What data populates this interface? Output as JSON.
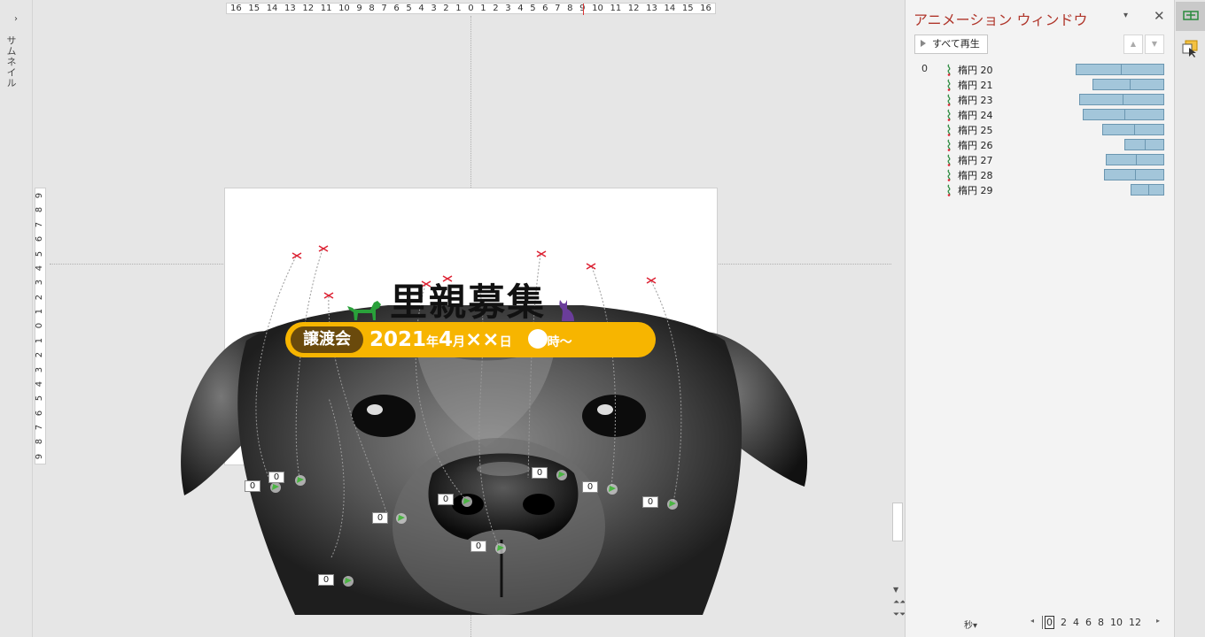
{
  "thumbnail_pane": {
    "toggle_glyph": "›",
    "label": "サムネイル"
  },
  "ruler": {
    "horizontal": [
      "16",
      "15",
      "14",
      "13",
      "12",
      "11",
      "10",
      "9",
      "8",
      "7",
      "6",
      "5",
      "4",
      "3",
      "2",
      "1",
      "0",
      "1",
      "2",
      "3",
      "4",
      "5",
      "6",
      "7",
      "8",
      "9",
      "10",
      "11",
      "12",
      "13",
      "14",
      "15",
      "16"
    ],
    "vertical": [
      "9",
      "8",
      "7",
      "6",
      "5",
      "4",
      "3",
      "2",
      "1",
      "0",
      "1",
      "2",
      "3",
      "4",
      "5",
      "6",
      "7",
      "8",
      "9"
    ]
  },
  "slide": {
    "title": "里親募集",
    "banner_tag": "譲渡会",
    "date_year": "2021",
    "date_year_unit": "年",
    "date_month": "4",
    "date_month_unit": "月",
    "date_day": "××",
    "date_day_unit": "日",
    "time_unit": "時～"
  },
  "motion_markers": [
    {
      "count": "0"
    },
    {
      "count": "0"
    },
    {
      "count": "0"
    },
    {
      "count": "0"
    },
    {
      "count": "0"
    },
    {
      "count": "0"
    },
    {
      "count": "0"
    },
    {
      "count": "0"
    },
    {
      "count": "0"
    }
  ],
  "scrollbar": {
    "down": "▼",
    "prev_slide": "⏶⏶",
    "next_slide": "⏷⏷"
  },
  "animation_pane": {
    "title": "アニメーション ウィンドウ",
    "menu_glyph": "▾",
    "close_glyph": "✕",
    "play_all": "すべて再生",
    "move_up": "▲",
    "move_down": "▼",
    "items": [
      {
        "num": "0",
        "name": "楕円 20",
        "start": 0.27,
        "end": 1.0,
        "tick": 0.5
      },
      {
        "num": "",
        "name": "楕円 21",
        "start": 0.41,
        "end": 1.0,
        "tick": 0.5
      },
      {
        "num": "",
        "name": "楕円 23",
        "start": 0.3,
        "end": 1.0,
        "tick": 0.5
      },
      {
        "num": "",
        "name": "楕円 24",
        "start": 0.33,
        "end": 1.0,
        "tick": 0.5
      },
      {
        "num": "",
        "name": "楕円 25",
        "start": 0.49,
        "end": 1.0,
        "tick": 0.5
      },
      {
        "num": "",
        "name": "楕円 26",
        "start": 0.67,
        "end": 1.0,
        "tick": 0.5
      },
      {
        "num": "",
        "name": "楕円 27",
        "start": 0.52,
        "end": 1.0,
        "tick": 0.5
      },
      {
        "num": "",
        "name": "楕円 28",
        "start": 0.5,
        "end": 1.0,
        "tick": 0.5
      },
      {
        "num": "",
        "name": "楕円 29",
        "start": 0.72,
        "end": 1.0,
        "tick": 0.5
      }
    ],
    "seconds_label": "秒▾",
    "timeline_ticks": [
      "0",
      "2",
      "4",
      "6",
      "8",
      "10",
      "12"
    ],
    "timeline_left": "◂",
    "timeline_right": "▸"
  },
  "colors": {
    "pane_title": "#b0362b",
    "banner": "#f7b500",
    "banner_tag_bg": "#6a4a0c",
    "anim_bar": "#a3c6da",
    "green_dog": "#29a13a",
    "purple_cat": "#6a3d9a"
  }
}
